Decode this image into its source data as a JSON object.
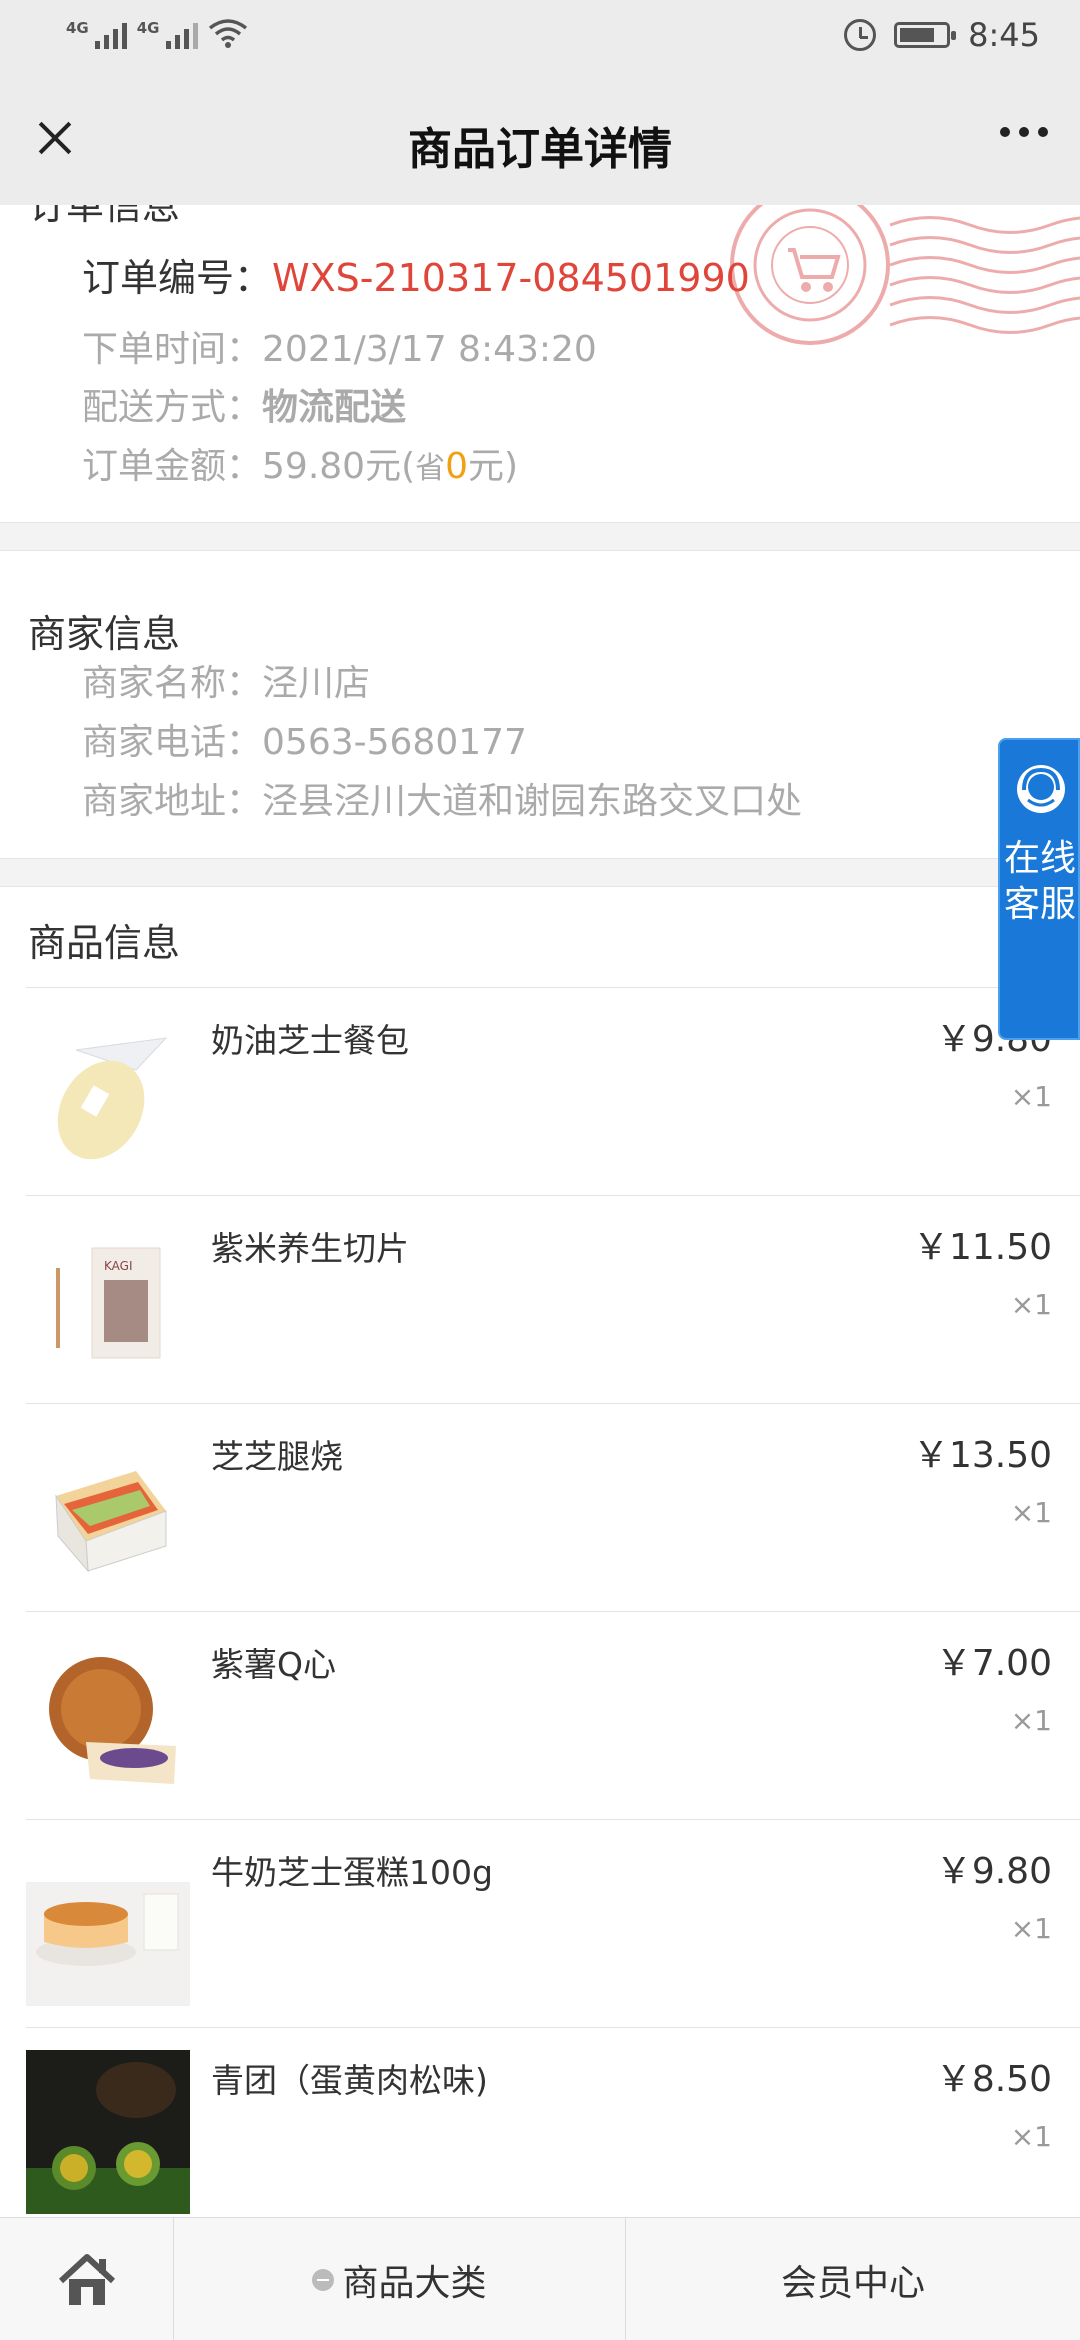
{
  "status_bar": {
    "signal1": "4G",
    "signal2": "4G",
    "time": "8:45"
  },
  "nav": {
    "title": "商品订单详情"
  },
  "order": {
    "section_title": "订单信息",
    "number_label": "订单编号：",
    "number_value": "WXS-210317-084501990",
    "time_label": "下单时间：",
    "time_value": "2021/3/17 8:43:20",
    "shipping_label": "配送方式：",
    "shipping_value": "物流配送",
    "amount_label": "订单金额：",
    "amount_value": "59.80元(",
    "amount_save_prefix": "省",
    "amount_save_value": "0",
    "amount_save_suffix": "元)"
  },
  "merchant": {
    "section_title": "商家信息",
    "name_label": "商家名称：",
    "name_value": "泾川店",
    "phone_label": "商家电话：",
    "phone_value": "0563-5680177",
    "address_label": "商家地址：",
    "address_value": "泾县泾川大道和谢园东路交叉口处"
  },
  "products": {
    "section_title": "商品信息",
    "items": [
      {
        "name": "奶油芝士餐包",
        "price": "￥9.80",
        "qty": "×1"
      },
      {
        "name": "紫米养生切片",
        "price": "￥11.50",
        "qty": "×1"
      },
      {
        "name": "芝芝腿烧",
        "price": "￥13.50",
        "qty": "×1"
      },
      {
        "name": "紫薯Q心",
        "price": "￥7.00",
        "qty": "×1"
      },
      {
        "name": "牛奶芝士蛋糕100g",
        "price": "￥9.80",
        "qty": "×1"
      },
      {
        "name": "青团（蛋黄肉松味)",
        "price": "￥8.50",
        "qty": "×1"
      }
    ]
  },
  "service_button": {
    "label": "在线客服"
  },
  "tabbar": {
    "category": "商品大类",
    "member": "会员中心"
  },
  "colors": {
    "accent_red": "#e0453a",
    "save_orange": "#f0a010",
    "service_blue": "#1a79d8"
  }
}
